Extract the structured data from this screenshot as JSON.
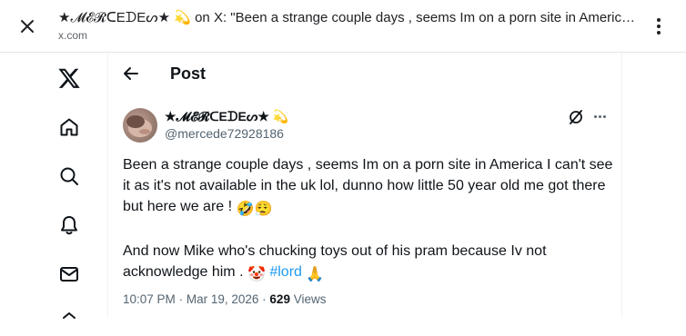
{
  "browser": {
    "title": "★𝓜𝓔𝓡ᑕEᗪEᔕ★ 💫 on X: \"Been a strange couple days , seems Im on a porn site in America I...",
    "url": "x.com"
  },
  "nav": {
    "items": [
      "x-logo",
      "home",
      "search",
      "notifications",
      "messages"
    ]
  },
  "post_header": {
    "back_icon": "arrow-left-icon",
    "title": "Post"
  },
  "author": {
    "name": "★𝓜𝓔𝓡ᑕEᗪEᔕ★",
    "name_emoji": "💫",
    "handle": "@mercede72928186"
  },
  "post": {
    "paragraph1": "Been a strange couple days , seems Im on a porn site in America I can't see it as it's not available in the uk lol, dunno how little 50 year old me got there but here we are !",
    "paragraph1_emojis": "🤣😮‍💨",
    "paragraph2": "And now Mike who's chucking toys out of his pram because Iv not acknowledge him .",
    "clown_emoji": "🤡",
    "hashtag": "#lord",
    "pray_emoji": "🙏"
  },
  "meta": {
    "time": "10:07 PM",
    "separator": "·",
    "date": "Mar 19, 2026",
    "views_count": "629",
    "views_label": "Views"
  },
  "colors": {
    "link": "#1d9bf0",
    "secondary_text": "#536471",
    "primary_text": "#0f1419"
  }
}
